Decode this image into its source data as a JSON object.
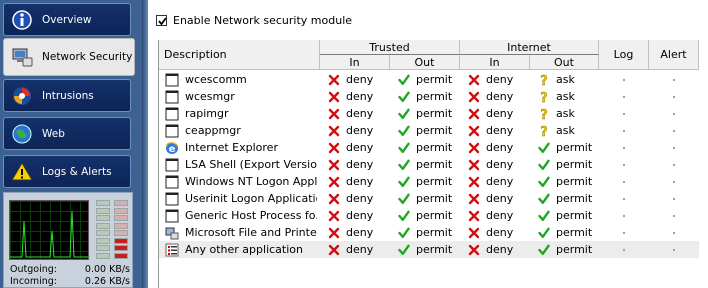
{
  "sidebar": {
    "items": [
      {
        "label": "Overview",
        "icon": "info-icon",
        "active": false
      },
      {
        "label": "Network Security",
        "icon": "network-computer-icon",
        "active": true
      },
      {
        "label": "Intrusions",
        "icon": "intrusion-swirl-icon",
        "active": false
      },
      {
        "label": "Web",
        "icon": "globe-icon",
        "active": false
      },
      {
        "label": "Logs & Alerts",
        "icon": "warning-icon",
        "active": false
      }
    ],
    "monitor": {
      "outgoing_label": "Outgoing:",
      "outgoing_value": "0.00 KB/s",
      "incoming_label": "Incoming:",
      "incoming_value": "0.26 KB/s"
    }
  },
  "main": {
    "enable_label": "Enable Network security module",
    "enable_checked": true,
    "columns": {
      "description": "Description",
      "trusted": "Trusted",
      "internet": "Internet",
      "in": "In",
      "out": "Out",
      "log": "Log",
      "alert": "Alert"
    },
    "rows": [
      {
        "name": "wcescomm",
        "icon": "blank-app-icon",
        "t_in": "deny",
        "t_out": "permit",
        "i_in": "deny",
        "i_out": "ask"
      },
      {
        "name": "wcesmgr",
        "icon": "blank-app-icon",
        "t_in": "deny",
        "t_out": "permit",
        "i_in": "deny",
        "i_out": "ask"
      },
      {
        "name": "rapimgr",
        "icon": "blank-app-icon",
        "t_in": "deny",
        "t_out": "permit",
        "i_in": "deny",
        "i_out": "ask"
      },
      {
        "name": "ceappmgr",
        "icon": "blank-app-icon",
        "t_in": "deny",
        "t_out": "permit",
        "i_in": "deny",
        "i_out": "ask"
      },
      {
        "name": "Internet Explorer",
        "icon": "ie-icon",
        "t_in": "deny",
        "t_out": "permit",
        "i_in": "deny",
        "i_out": "permit"
      },
      {
        "name": "LSA Shell (Export Version)",
        "icon": "blank-app-icon",
        "t_in": "deny",
        "t_out": "permit",
        "i_in": "deny",
        "i_out": "permit"
      },
      {
        "name": "Windows NT Logon Appl...",
        "icon": "blank-app-icon",
        "t_in": "deny",
        "t_out": "permit",
        "i_in": "deny",
        "i_out": "permit"
      },
      {
        "name": "Userinit Logon Application",
        "icon": "blank-app-icon",
        "t_in": "deny",
        "t_out": "permit",
        "i_in": "deny",
        "i_out": "permit"
      },
      {
        "name": "Generic Host Process fo...",
        "icon": "blank-app-icon",
        "t_in": "deny",
        "t_out": "permit",
        "i_in": "deny",
        "i_out": "permit"
      },
      {
        "name": "Microsoft File and Printe...",
        "icon": "file-printer-icon",
        "t_in": "deny",
        "t_out": "permit",
        "i_in": "deny",
        "i_out": "permit"
      },
      {
        "name": "Any other application",
        "icon": "list-app-icon",
        "t_in": "deny",
        "t_out": "permit",
        "i_in": "deny",
        "i_out": "permit"
      }
    ]
  },
  "colors": {
    "deny": "#d01010",
    "permit": "#1fa81f",
    "ask": "#e8c800",
    "sidebar": "#3d6292",
    "nav_item": "#14316a"
  }
}
